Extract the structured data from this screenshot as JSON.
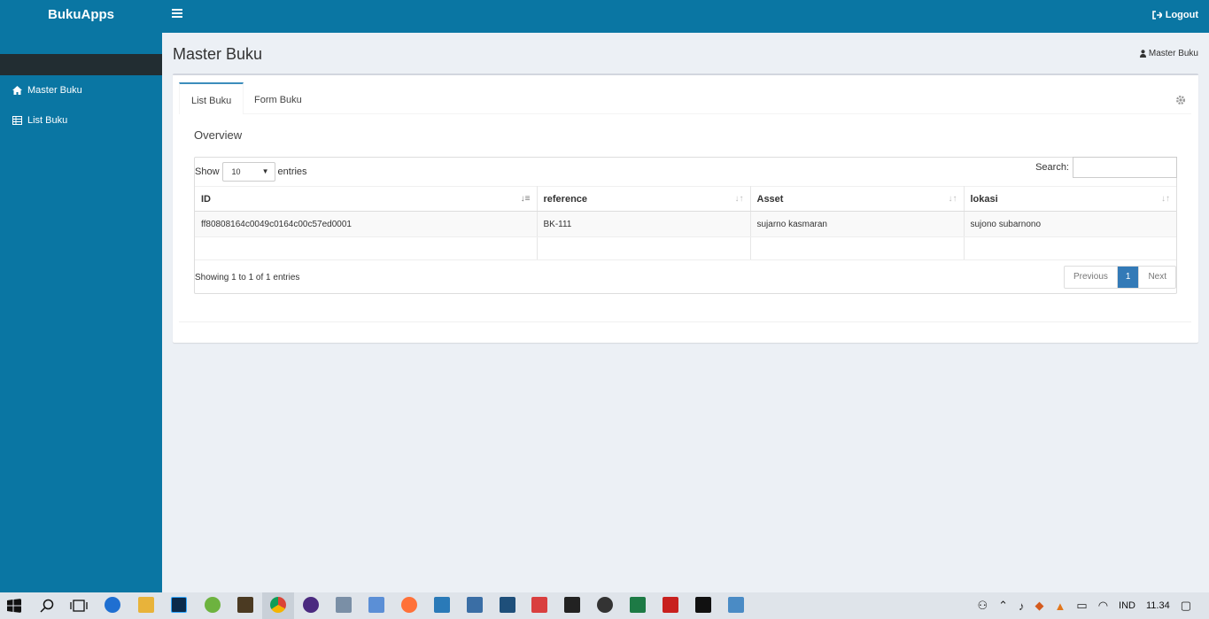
{
  "header": {
    "brand": "BukuApps",
    "logout_label": "Logout"
  },
  "sidebar": {
    "items": [
      {
        "label": "Master Buku",
        "icon": "home-icon"
      },
      {
        "label": "List Buku",
        "icon": "table-icon"
      }
    ]
  },
  "content": {
    "title": "Master Buku",
    "breadcrumb": "Master Buku"
  },
  "tabs": [
    {
      "label": "List Buku",
      "active": true
    },
    {
      "label": "Form Buku",
      "active": false
    }
  ],
  "overview_title": "Overview",
  "datatable": {
    "show_label": "Show",
    "entries_label": "entries",
    "page_length": "10",
    "search_label": "Search:",
    "search_value": "",
    "columns": [
      "ID",
      "reference",
      "Asset",
      "lokasi"
    ],
    "rows": [
      [
        "ff80808164c0049c0164c00c57ed0001",
        "BK-111",
        "sujarno kasmaran",
        "sujono subarnono"
      ]
    ],
    "info": "Showing 1 to 1 of 1 entries",
    "pagination": {
      "previous": "Previous",
      "current": "1",
      "next": "Next"
    }
  },
  "taskbar": {
    "language": "IND",
    "time": "11.34"
  },
  "colors": {
    "primary": "#0a76a3",
    "accent": "#337ab7",
    "sidebar_dark": "#222d32"
  }
}
